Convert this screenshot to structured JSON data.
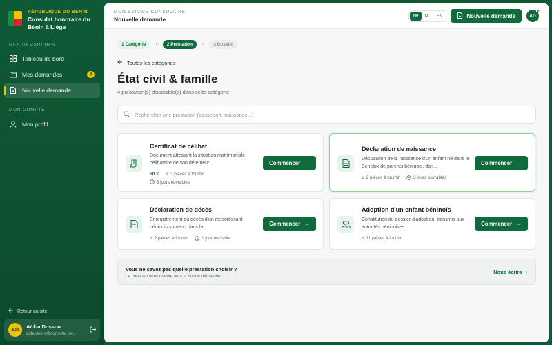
{
  "sidebar": {
    "kicker": "RÉPUBLIQUE DU BÉNIN",
    "title_line1": "Consulat honoraire du",
    "title_line2": "Bénin à Liège",
    "section1": "MES DÉMARCHES",
    "items": [
      {
        "label": "Tableau de bord",
        "icon": "dashboard-icon"
      },
      {
        "label": "Mes demandes",
        "icon": "folder-icon",
        "badge": "7"
      },
      {
        "label": "Nouvelle demande",
        "icon": "file-plus-icon",
        "active": true
      }
    ],
    "section2": "MON COMPTE",
    "profile": {
      "label": "Mon profil",
      "icon": "user-icon"
    },
    "back_site": "Retour au site",
    "user": {
      "initials": "AD",
      "name": "Aïcha Dossou",
      "email": "aide.demo@consulat.inv..."
    }
  },
  "topbar": {
    "kicker": "MON ESPACE CONSULAIRE",
    "title": "Nouvelle demande",
    "langs": [
      "FR",
      "NL",
      "EN"
    ],
    "active_lang": "FR",
    "new_button": "Nouvelle demande",
    "avatar": "AD"
  },
  "steps": [
    {
      "num": "1",
      "label": "Catégorie",
      "state": "done"
    },
    {
      "num": "2",
      "label": "Prestation",
      "state": "current"
    },
    {
      "num": "3",
      "label": "Dossier",
      "state": "next"
    }
  ],
  "back_link": "Toutes les catégories",
  "page_title": "État civil & famille",
  "count_text": "4 prestation(s) disponible(s) dans cette catégorie.",
  "search": {
    "placeholder": "Rechercher une prestation (passeport, naissance...)"
  },
  "cards": [
    {
      "title": "Certificat de célibat",
      "desc": "Document attestant la situation matrimoniale célibataire de son détenteur...",
      "price": "50 €",
      "pieces": "3 pièces à fournir",
      "delay": "3 jours ouvrables",
      "cta": "Commencer",
      "icon": "scroll-icon"
    },
    {
      "title": "Déclaration de naissance",
      "desc": "Déclaration de la naissance d'un enfant né dans le Benelux de parents béninois, dan...",
      "pieces": "2 pièces à fournir",
      "delay": "3 jours ouvrables",
      "cta": "Commencer",
      "icon": "document-icon"
    },
    {
      "title": "Déclaration de décès",
      "desc": "Enregistrement du décès d'un ressortissant béninois survenu dans la...",
      "pieces": "2 pièces à fournir",
      "delay": "1 jour ouvrable",
      "cta": "Commencer",
      "icon": "document-icon"
    },
    {
      "title": "Adoption d'un enfant béninois",
      "desc": "Constitution du dossier d'adoption, transmis aux autorités béninoises...",
      "pieces": "11 pièces à fournir",
      "cta": "Commencer",
      "icon": "users-icon"
    }
  ],
  "help": {
    "title": "Vous ne savez pas quelle prestation choisir ?",
    "subtitle": "Le consulat vous oriente vers la bonne démarche.",
    "link": "Nous écrire"
  }
}
